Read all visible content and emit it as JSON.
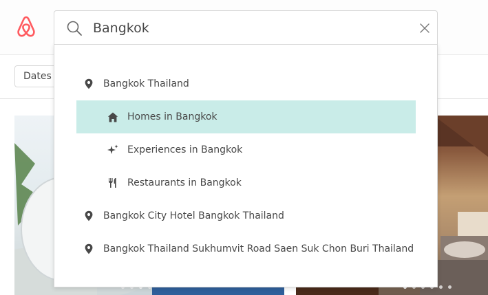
{
  "search": {
    "query": "Bangkok",
    "placeholder": ""
  },
  "filters": {
    "dates_label": "Dates"
  },
  "suggestions": [
    {
      "label": "Bangkok Thailand",
      "icon": "location-pin-icon"
    },
    {
      "label": "Homes in Bangkok",
      "icon": "home-icon",
      "highlighted": true
    },
    {
      "label": "Experiences in Bangkok",
      "icon": "sparkle-icon"
    },
    {
      "label": "Restaurants in Bangkok",
      "icon": "fork-knife-icon"
    },
    {
      "label": "Bangkok City Hotel Bangkok Thailand",
      "icon": "location-pin-icon"
    },
    {
      "label": "Bangkok Thailand Sukhumvit Road Saen Suk Chon Buri Thailand",
      "icon": "location-pin-icon"
    }
  ],
  "colors": {
    "brand": "#ff5a5f",
    "highlight": "#c9ece8",
    "text": "#484848"
  }
}
